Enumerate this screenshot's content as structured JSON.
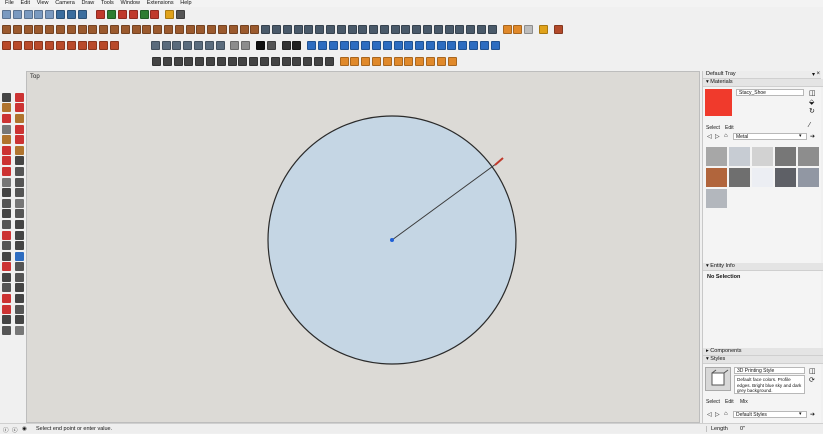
{
  "menu": [
    "File",
    "Edit",
    "View",
    "Camera",
    "Draw",
    "Tools",
    "Window",
    "Extensions",
    "Help"
  ],
  "scene": {
    "label": "Top"
  },
  "tray": {
    "title": "Default Tray",
    "materials": {
      "header": "Materials",
      "current_material": "Stacy_Shoe",
      "current_color": "#f03a2c",
      "tabs": [
        "Select",
        "Edit"
      ],
      "library": "Metal",
      "swatch_colors": [
        "#a7a7a7",
        "#c7ccd3",
        "#d2d2d2",
        "#777777",
        "#8d8d8d",
        "#b1653c",
        "#6f6f6f",
        "#eceef3",
        "#5e6066",
        "#9197a3",
        "#b3b7bd"
      ]
    },
    "entity_info": {
      "header": "Entity Info",
      "selection": "No Selection"
    },
    "components": {
      "header": "Components"
    },
    "styles": {
      "header": "Styles",
      "style_name": "3D Printing Style",
      "description": "Default face colors. Profile edges. Bright blue sky and dark grey background.",
      "tabs": [
        "Select",
        "Edit",
        "Mix"
      ],
      "collection": "Default Styles"
    }
  },
  "status": {
    "hint": "Select end point or enter value.",
    "length_label": "Length",
    "length_value": "0\""
  },
  "colors": {
    "circle_fill": "#c5d6e4",
    "viewport_bg": "#dcdad6",
    "radius_endpoint": "#1f5fd6"
  }
}
